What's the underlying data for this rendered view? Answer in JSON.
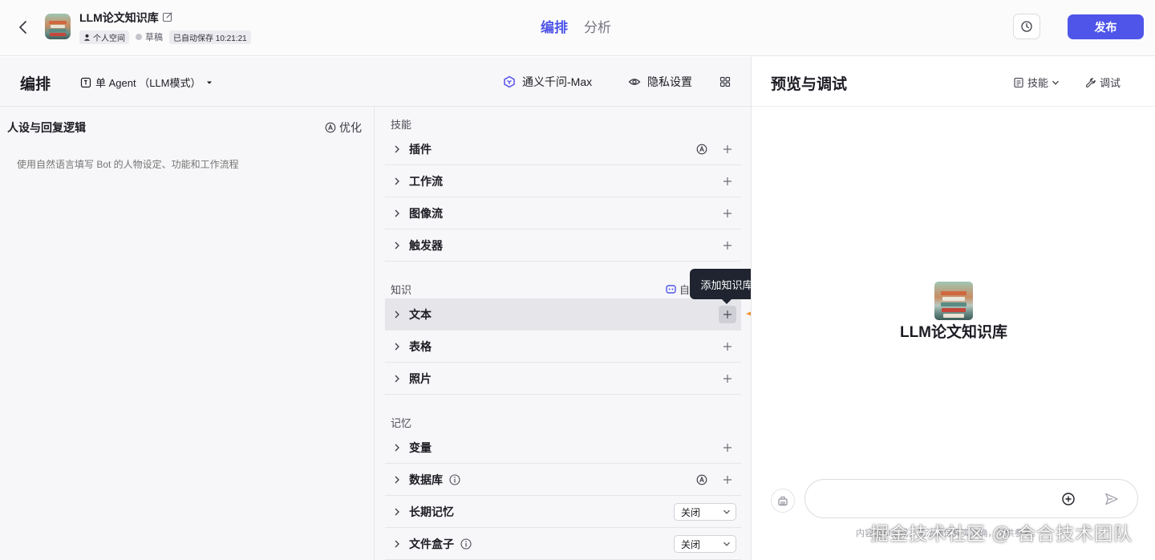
{
  "header": {
    "bot_name": "LLM论文知识库",
    "space": "个人空间",
    "status": "草稿",
    "autosave": "已自动保存 10:21:21",
    "tabs": [
      {
        "label": "编排",
        "active": true
      },
      {
        "label": "分析",
        "active": false
      }
    ],
    "publish_label": "发布",
    "accent_color": "#4e55e8"
  },
  "editor": {
    "title": "编排",
    "mode": "单 Agent （LLM模式）",
    "model": "通义千问-Max",
    "privacy": "隐私设置",
    "persona": {
      "title": "人设与回复逻辑",
      "optimize": "优化",
      "placeholder": "使用自然语言填写 Bot 的人物设定、功能和工作流程"
    },
    "sections": {
      "skills": {
        "title": "技能",
        "items": [
          "插件",
          "工作流",
          "图像流",
          "触发器"
        ]
      },
      "knowledge": {
        "title": "知识",
        "auto": "自",
        "items": [
          "文本",
          "表格",
          "照片"
        ]
      },
      "memory": {
        "title": "记忆",
        "items": [
          "变量",
          "数据库",
          "长期记忆",
          "文件盒子"
        ],
        "long_memory_value": "关闭",
        "file_box_value": "关闭"
      }
    },
    "tooltip": "添加知识库"
  },
  "preview": {
    "title": "预览与调试",
    "skill_btn": "技能",
    "debug_btn": "调试",
    "bot_name": "LLM论文知识库",
    "disclaimer": "内容由AI生成，无法确保真实准确，仅供参考。"
  },
  "watermark": "掘金技术社区 @ 合合技术团队"
}
